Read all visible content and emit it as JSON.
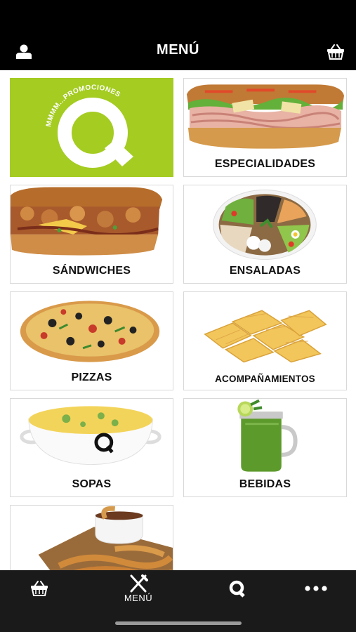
{
  "header": {
    "title": "MENÚ",
    "user_icon": "user-icon",
    "basket_icon": "basket-icon"
  },
  "promo": {
    "text": "MMMM...PROMOCIONES",
    "logo_letter": "Q",
    "color": "#a4cc21"
  },
  "categories": [
    {
      "label": "ESPECIALIDADES"
    },
    {
      "label": "SÁNDWICHES"
    },
    {
      "label": "ENSALADAS"
    },
    {
      "label": "PIZZAS"
    },
    {
      "label": "ACOMPAÑAMIENTOS"
    },
    {
      "label": "SOPAS",
      "bowl_letter": "Q"
    },
    {
      "label": "BEBIDAS"
    }
  ],
  "tabbar": {
    "items": [
      {
        "icon": "basket-icon",
        "label": ""
      },
      {
        "icon": "fork-knife-icon",
        "label": "MENÚ"
      },
      {
        "icon": "q-logo-icon",
        "label": ""
      },
      {
        "icon": "more-dots-icon",
        "label": ""
      }
    ]
  }
}
